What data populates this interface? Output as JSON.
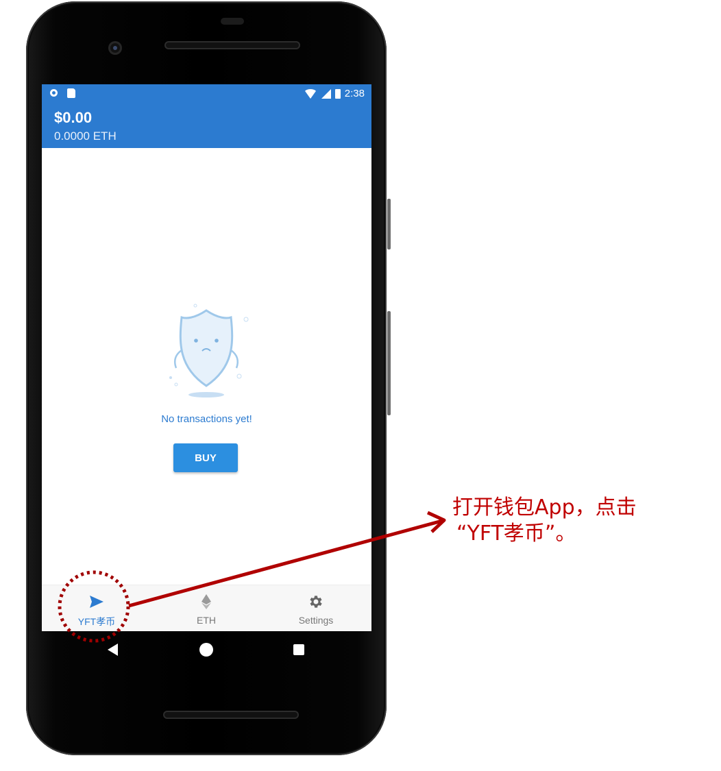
{
  "status_bar": {
    "time": "2:38"
  },
  "wallet": {
    "balance_usd": "$0.00",
    "balance_eth": "0.0000 ETH"
  },
  "empty_state": {
    "message": "No transactions yet!",
    "buy_label": "BUY"
  },
  "tabs": [
    {
      "label": "YFT孝币",
      "icon": "send-icon",
      "active": true
    },
    {
      "label": "ETH",
      "icon": "ethereum-icon",
      "active": false
    },
    {
      "label": "Settings",
      "icon": "gear-icon",
      "active": false
    }
  ],
  "annotation": {
    "line1": "打开钱包App，点击",
    "line2": "“YFT孝币”。"
  },
  "colors": {
    "primary": "#2c7bd0",
    "annotation": "#c00000"
  }
}
